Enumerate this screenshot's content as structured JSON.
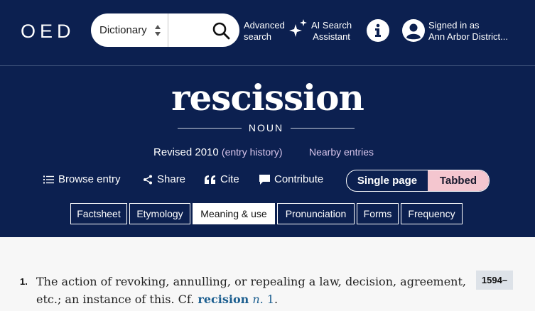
{
  "brand": {
    "logo": "OED"
  },
  "search": {
    "select_value": "Dictionary",
    "input_value": "",
    "input_placeholder": ""
  },
  "nav": {
    "advanced_line1": "Advanced",
    "advanced_line2": "search",
    "ai_line1": "AI Search",
    "ai_line2": "Assistant",
    "signin_line1": "Signed in as",
    "signin_line2": "Ann Arbor District..."
  },
  "entry": {
    "headword": "rescission",
    "pos": "NOUN",
    "revised": "Revised 2010",
    "history": "(entry history)",
    "nearby": "Nearby entries"
  },
  "actions": {
    "browse": "Browse entry",
    "share": "Share",
    "cite": "Cite",
    "contribute": "Contribute"
  },
  "view_toggle": {
    "single": "Single page",
    "tabbed": "Tabbed",
    "selected": "Tabbed"
  },
  "tabs": [
    {
      "label": "Factsheet",
      "active": false
    },
    {
      "label": "Etymology",
      "active": false
    },
    {
      "label": "Meaning & use",
      "active": true
    },
    {
      "label": "Pronunciation",
      "active": false
    },
    {
      "label": "Forms",
      "active": false
    },
    {
      "label": "Frequency",
      "active": false
    }
  ],
  "sense": {
    "number": "1.",
    "text": "The action of revoking, annulling, or repealing a law, decision, agreement, etc.; an instance of this. Cf.",
    "xref_word": "recision",
    "xref_pos": "n.",
    "xref_num": "1",
    "date": "1594–"
  },
  "colors": {
    "header_bg": "#0c2050",
    "accent_pink": "#f4c6cf",
    "link_lavender": "#d9c6ec",
    "xref_blue": "#1b5e8f"
  }
}
